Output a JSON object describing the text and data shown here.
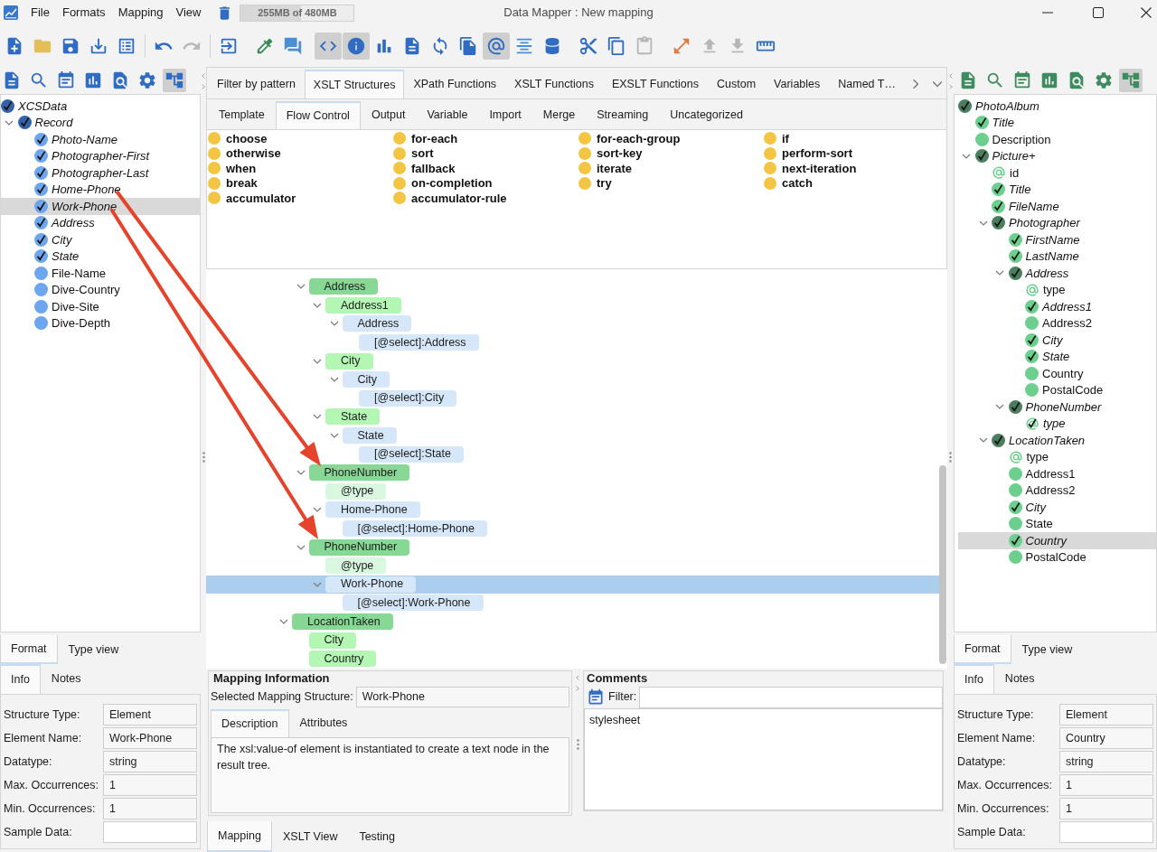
{
  "title_bar": {
    "menus": [
      {
        "label": "File"
      },
      {
        "label": "Formats"
      },
      {
        "label": "Mapping"
      },
      {
        "label": "View"
      }
    ],
    "memory": {
      "text": "255MB of 480MB",
      "level": 0.53
    },
    "title": "Data Mapper : New mapping"
  },
  "toolbar": {
    "buttons": [
      {
        "pressed": false,
        "disabled": false
      },
      {
        "pressed": false,
        "disabled": false
      },
      {
        "pressed": false,
        "disabled": false
      },
      {
        "pressed": false,
        "disabled": false
      },
      {
        "pressed": false,
        "disabled": false
      },
      {
        "pressed": false,
        "disabled": false
      },
      {
        "pressed": false,
        "disabled": true
      },
      {
        "pressed": false,
        "disabled": false
      },
      {
        "pressed": false,
        "disabled": false
      },
      {
        "pressed": false,
        "disabled": false
      },
      {
        "pressed": true,
        "disabled": false
      },
      {
        "pressed": true,
        "disabled": false
      },
      {
        "pressed": false,
        "disabled": false
      },
      {
        "pressed": false,
        "disabled": false
      },
      {
        "pressed": false,
        "disabled": false
      },
      {
        "pressed": false,
        "disabled": false
      },
      {
        "pressed": true,
        "disabled": false
      },
      {
        "pressed": false,
        "disabled": false
      },
      {
        "pressed": false,
        "disabled": false
      },
      {
        "pressed": false,
        "disabled": false
      },
      {
        "pressed": false,
        "disabled": false
      },
      {
        "pressed": false,
        "disabled": true
      },
      {
        "pressed": false,
        "disabled": false
      },
      {
        "pressed": false,
        "disabled": true
      },
      {
        "pressed": false,
        "disabled": true
      },
      {
        "pressed": false,
        "disabled": false
      }
    ]
  },
  "source_panel": {
    "toolbar": {
      "buttons": [
        {
          "pressed": false
        },
        {
          "pressed": false
        },
        {
          "pressed": false
        },
        {
          "pressed": false
        },
        {
          "pressed": false
        },
        {
          "pressed": false
        },
        {
          "pressed": true
        }
      ]
    },
    "tree": [
      {
        "label": "XCSData",
        "kind": "element",
        "mapped": true,
        "selected": false,
        "children": [
          {
            "label": "Record",
            "kind": "element",
            "mapped": true,
            "selected": false,
            "expanded": true,
            "children": [
              {
                "label": "Photo-Name",
                "kind": "element",
                "mapped": true,
                "selected": false
              },
              {
                "label": "Photographer-First",
                "kind": "element",
                "mapped": true,
                "selected": false
              },
              {
                "label": "Photographer-Last",
                "kind": "element",
                "mapped": true,
                "selected": false
              },
              {
                "label": "Home-Phone",
                "kind": "element",
                "mapped": true,
                "selected": false
              },
              {
                "label": "Work-Phone",
                "kind": "element",
                "mapped": true,
                "selected": true
              },
              {
                "label": "Address",
                "kind": "element",
                "mapped": true,
                "selected": false
              },
              {
                "label": "City",
                "kind": "element",
                "mapped": true,
                "selected": false
              },
              {
                "label": "State",
                "kind": "element",
                "mapped": true,
                "selected": false
              },
              {
                "label": "File-Name",
                "kind": "element",
                "mapped": false,
                "selected": false
              },
              {
                "label": "Dive-Country",
                "kind": "element",
                "mapped": false,
                "selected": false
              },
              {
                "label": "Dive-Site",
                "kind": "element",
                "mapped": false,
                "selected": false
              },
              {
                "label": "Dive-Depth",
                "kind": "element",
                "mapped": false,
                "selected": false
              }
            ]
          }
        ]
      }
    ],
    "view_tabs": [
      {
        "label": "Format",
        "selected": true
      },
      {
        "label": "Type view",
        "selected": false
      }
    ],
    "info_tabs": [
      {
        "label": "Info",
        "selected": true
      },
      {
        "label": "Notes",
        "selected": false
      }
    ],
    "properties": [
      {
        "label": "Structure Type:",
        "value": "Element"
      },
      {
        "label": "Element Name:",
        "value": "Work-Phone"
      },
      {
        "label": "Datatype:",
        "value": "string"
      },
      {
        "label": "Max. Occurrences:",
        "value": "1"
      },
      {
        "label": "Min. Occurrences:",
        "value": "1"
      },
      {
        "label": "Sample Data:"
      }
    ]
  },
  "palette": {
    "tabs": [
      {
        "label": "Filter by pattern",
        "selected": false
      },
      {
        "label": "XSLT Structures",
        "selected": true
      },
      {
        "label": "XPath Functions",
        "selected": false
      },
      {
        "label": "XSLT Functions",
        "selected": false
      },
      {
        "label": "EXSLT Functions",
        "selected": false
      },
      {
        "label": "Custom",
        "selected": false
      },
      {
        "label": "Variables",
        "selected": false
      },
      {
        "label": "Named T…",
        "selected": false
      }
    ],
    "subtabs": [
      {
        "label": "Template",
        "selected": false
      },
      {
        "label": "Flow Control",
        "selected": true
      },
      {
        "label": "Output",
        "selected": false
      },
      {
        "label": "Variable",
        "selected": false
      },
      {
        "label": "Import",
        "selected": false
      },
      {
        "label": "Merge",
        "selected": false
      },
      {
        "label": "Streaming",
        "selected": false
      },
      {
        "label": "Uncategorized",
        "selected": false
      }
    ],
    "items": [
      "choose",
      "for-each",
      "for-each-group",
      "if",
      "otherwise",
      "sort",
      "sort-key",
      "perform-sort",
      "when",
      "fallback",
      "iterate",
      "next-iteration",
      "break",
      "on-completion",
      "try",
      "catch",
      "accumulator",
      "accumulator-rule"
    ]
  },
  "mapping_tree": {
    "nodes": [
      {
        "children": [
          {
            "label": "Address",
            "kind": "output",
            "expanded": true,
            "selected": false,
            "children": [
              {
                "label": "Address1",
                "kind": "element",
                "expanded": true,
                "selected": false,
                "children": [
                  {
                    "label": "Address",
                    "kind": "value",
                    "expanded": true,
                    "selected": false,
                    "children": [
                      {
                        "label": "[@select]:Address",
                        "kind": "value",
                        "selected": false
                      }
                    ]
                  }
                ]
              },
              {
                "label": "City",
                "kind": "element",
                "expanded": true,
                "selected": false,
                "children": [
                  {
                    "label": "City",
                    "kind": "value",
                    "expanded": true,
                    "selected": false,
                    "children": [
                      {
                        "label": "[@select]:City",
                        "kind": "value",
                        "selected": false
                      }
                    ]
                  }
                ]
              },
              {
                "label": "State",
                "kind": "element",
                "expanded": true,
                "selected": false,
                "children": [
                  {
                    "label": "State",
                    "kind": "value",
                    "expanded": true,
                    "selected": false,
                    "children": [
                      {
                        "label": "[@select]:State",
                        "kind": "value",
                        "selected": false
                      }
                    ]
                  }
                ]
              }
            ]
          },
          {
            "label": "PhoneNumber",
            "kind": "output",
            "expanded": true,
            "selected": false,
            "children": [
              {
                "label": "@type",
                "kind": "attribute",
                "selected": false
              },
              {
                "label": "Home-Phone",
                "kind": "value",
                "expanded": true,
                "selected": false,
                "children": [
                  {
                    "label": "[@select]:Home-Phone",
                    "kind": "value",
                    "selected": false
                  }
                ]
              }
            ]
          },
          {
            "label": "PhoneNumber",
            "kind": "output",
            "expanded": true,
            "selected": false,
            "children": [
              {
                "label": "@type",
                "kind": "attribute",
                "selected": false
              },
              {
                "label": "Work-Phone",
                "kind": "value",
                "expanded": true,
                "selected": true,
                "children": [
                  {
                    "label": "[@select]:Work-Phone",
                    "kind": "value",
                    "selected": false
                  }
                ]
              }
            ]
          }
        ]
      },
      {
        "label": "LocationTaken",
        "kind": "output",
        "expanded": true,
        "selected": false,
        "children": [
          {
            "label": "City",
            "kind": "element",
            "selected": false
          },
          {
            "label": "Country",
            "kind": "element",
            "selected": false
          }
        ]
      }
    ]
  },
  "mapping_info": {
    "title": "Mapping Information",
    "selected_label": "Selected Mapping Structure:",
    "selected_value": "Work-Phone",
    "tabs": [
      {
        "label": "Description",
        "selected": true
      },
      {
        "label": "Attributes",
        "selected": false
      }
    ],
    "description": "The xsl:value-of element is instantiated to create a text node in the result tree."
  },
  "comments": {
    "title": "Comments",
    "filter_label": "Filter:",
    "text": "stylesheet"
  },
  "view_tabs": [
    {
      "label": "Mapping",
      "selected": true
    },
    {
      "label": "XSLT View",
      "selected": false
    },
    {
      "label": "Testing",
      "selected": false
    }
  ],
  "target_panel": {
    "toolbar": {
      "buttons": [
        {
          "pressed": false
        },
        {
          "pressed": false
        },
        {
          "pressed": false
        },
        {
          "pressed": false
        },
        {
          "pressed": false
        },
        {
          "pressed": false
        },
        {
          "pressed": true
        }
      ]
    },
    "tree": [
      {
        "label": "PhotoAlbum",
        "kind": "element",
        "mapped": true,
        "selected": false,
        "children": [
          {
            "label": "Title",
            "kind": "element",
            "mapped": true,
            "selected": false
          },
          {
            "label": "Description",
            "kind": "element",
            "mapped": false,
            "selected": false
          },
          {
            "label": "Picture+",
            "kind": "element",
            "mapped": true,
            "selected": false,
            "expanded": true,
            "children": [
              {
                "label": "id",
                "kind": "attribute",
                "mapped": false,
                "selected": false
              },
              {
                "label": "Title",
                "kind": "element",
                "mapped": true,
                "selected": false
              },
              {
                "label": "FileName",
                "kind": "element",
                "mapped": true,
                "selected": false
              },
              {
                "label": "Photographer",
                "kind": "element",
                "mapped": true,
                "selected": false,
                "expanded": true,
                "children": [
                  {
                    "label": "FirstName",
                    "kind": "element",
                    "mapped": true,
                    "selected": false
                  },
                  {
                    "label": "LastName",
                    "kind": "element",
                    "mapped": true,
                    "selected": false
                  },
                  {
                    "label": "Address",
                    "kind": "element",
                    "mapped": true,
                    "selected": false,
                    "expanded": true,
                    "children": [
                      {
                        "label": "type",
                        "kind": "attribute",
                        "mapped": false,
                        "selected": false
                      },
                      {
                        "label": "Address1",
                        "kind": "element",
                        "mapped": true,
                        "selected": false
                      },
                      {
                        "label": "Address2",
                        "kind": "element",
                        "mapped": false,
                        "selected": false
                      },
                      {
                        "label": "City",
                        "kind": "element",
                        "mapped": true,
                        "selected": false
                      },
                      {
                        "label": "State",
                        "kind": "element",
                        "mapped": true,
                        "selected": false
                      },
                      {
                        "label": "Country",
                        "kind": "element",
                        "mapped": false,
                        "selected": false
                      },
                      {
                        "label": "PostalCode",
                        "kind": "element",
                        "mapped": false,
                        "selected": false
                      }
                    ]
                  },
                  {
                    "label": "PhoneNumber",
                    "kind": "element",
                    "mapped": true,
                    "selected": false,
                    "expanded": true,
                    "children": [
                      {
                        "label": "type",
                        "kind": "attribute",
                        "mapped": true,
                        "selected": false
                      }
                    ]
                  }
                ]
              },
              {
                "label": "LocationTaken",
                "kind": "element",
                "mapped": true,
                "selected": false,
                "expanded": true,
                "children": [
                  {
                    "label": "type",
                    "kind": "attribute",
                    "mapped": false,
                    "selected": false
                  },
                  {
                    "label": "Address1",
                    "kind": "element",
                    "mapped": false,
                    "selected": false
                  },
                  {
                    "label": "Address2",
                    "kind": "element",
                    "mapped": false,
                    "selected": false
                  },
                  {
                    "label": "City",
                    "kind": "element",
                    "mapped": true,
                    "selected": false
                  },
                  {
                    "label": "State",
                    "kind": "element",
                    "mapped": false,
                    "selected": false
                  },
                  {
                    "label": "Country",
                    "kind": "element",
                    "mapped": true,
                    "selected": true
                  },
                  {
                    "label": "PostalCode",
                    "kind": "element",
                    "mapped": false,
                    "selected": false
                  }
                ]
              }
            ]
          }
        ]
      }
    ],
    "view_tabs": [
      {
        "label": "Format",
        "selected": true
      },
      {
        "label": "Type view",
        "selected": false
      }
    ],
    "info_tabs": [
      {
        "label": "Info",
        "selected": true
      },
      {
        "label": "Notes",
        "selected": false
      }
    ],
    "properties": [
      {
        "label": "Structure Type:",
        "value": "Element"
      },
      {
        "label": "Element Name:",
        "value": "Country"
      },
      {
        "label": "Datatype:",
        "value": "string"
      },
      {
        "label": "Max. Occurrences:",
        "value": "1"
      },
      {
        "label": "Min. Occurrences:",
        "value": "1"
      },
      {
        "label": "Sample Data:"
      }
    ]
  }
}
